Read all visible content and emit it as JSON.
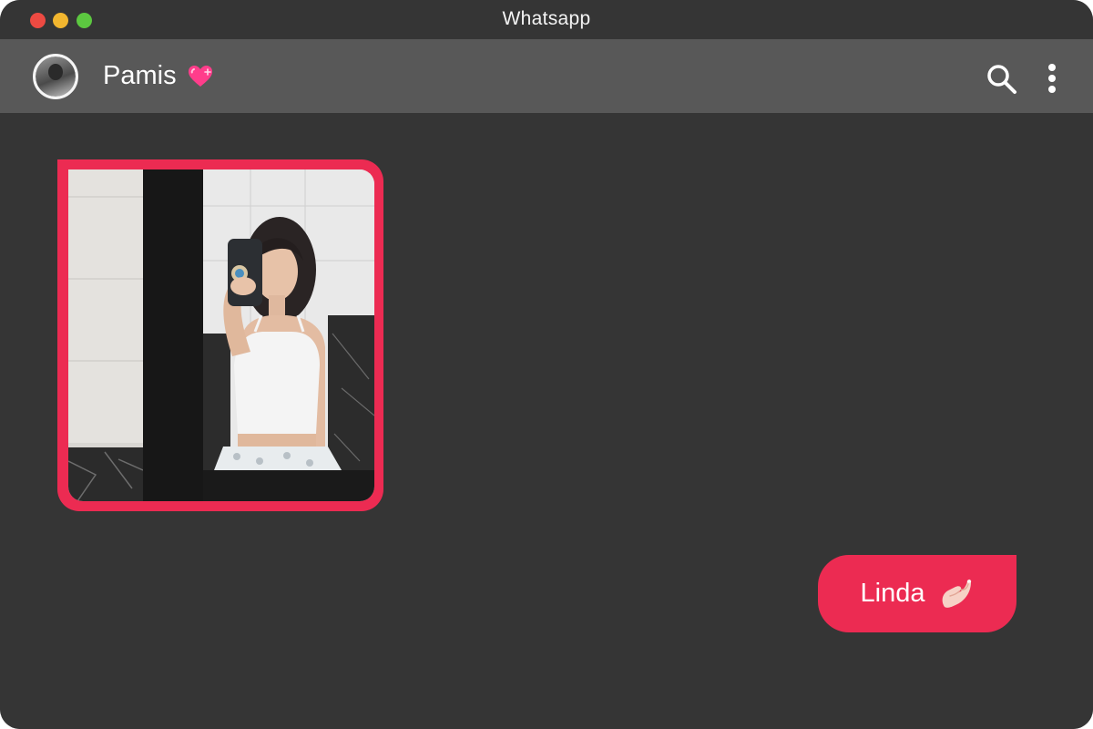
{
  "window": {
    "title": "Whatsapp"
  },
  "chat": {
    "contact_name": "Pamis",
    "contact_emoji": "heart-icon",
    "messages": [
      {
        "type": "image",
        "direction": "received",
        "description_icon": "photo"
      },
      {
        "type": "text",
        "direction": "sent",
        "text": "Linda",
        "emoji": "pinch-icon"
      }
    ]
  },
  "icons": {
    "search": "search-icon",
    "menu": "more-vertical-icon"
  },
  "colors": {
    "window_bg": "#353535",
    "header_bg": "#585858",
    "accent": "#ec2b52",
    "close": "#ed4a42",
    "minimize": "#f2b62f",
    "maximize": "#5cc840"
  }
}
